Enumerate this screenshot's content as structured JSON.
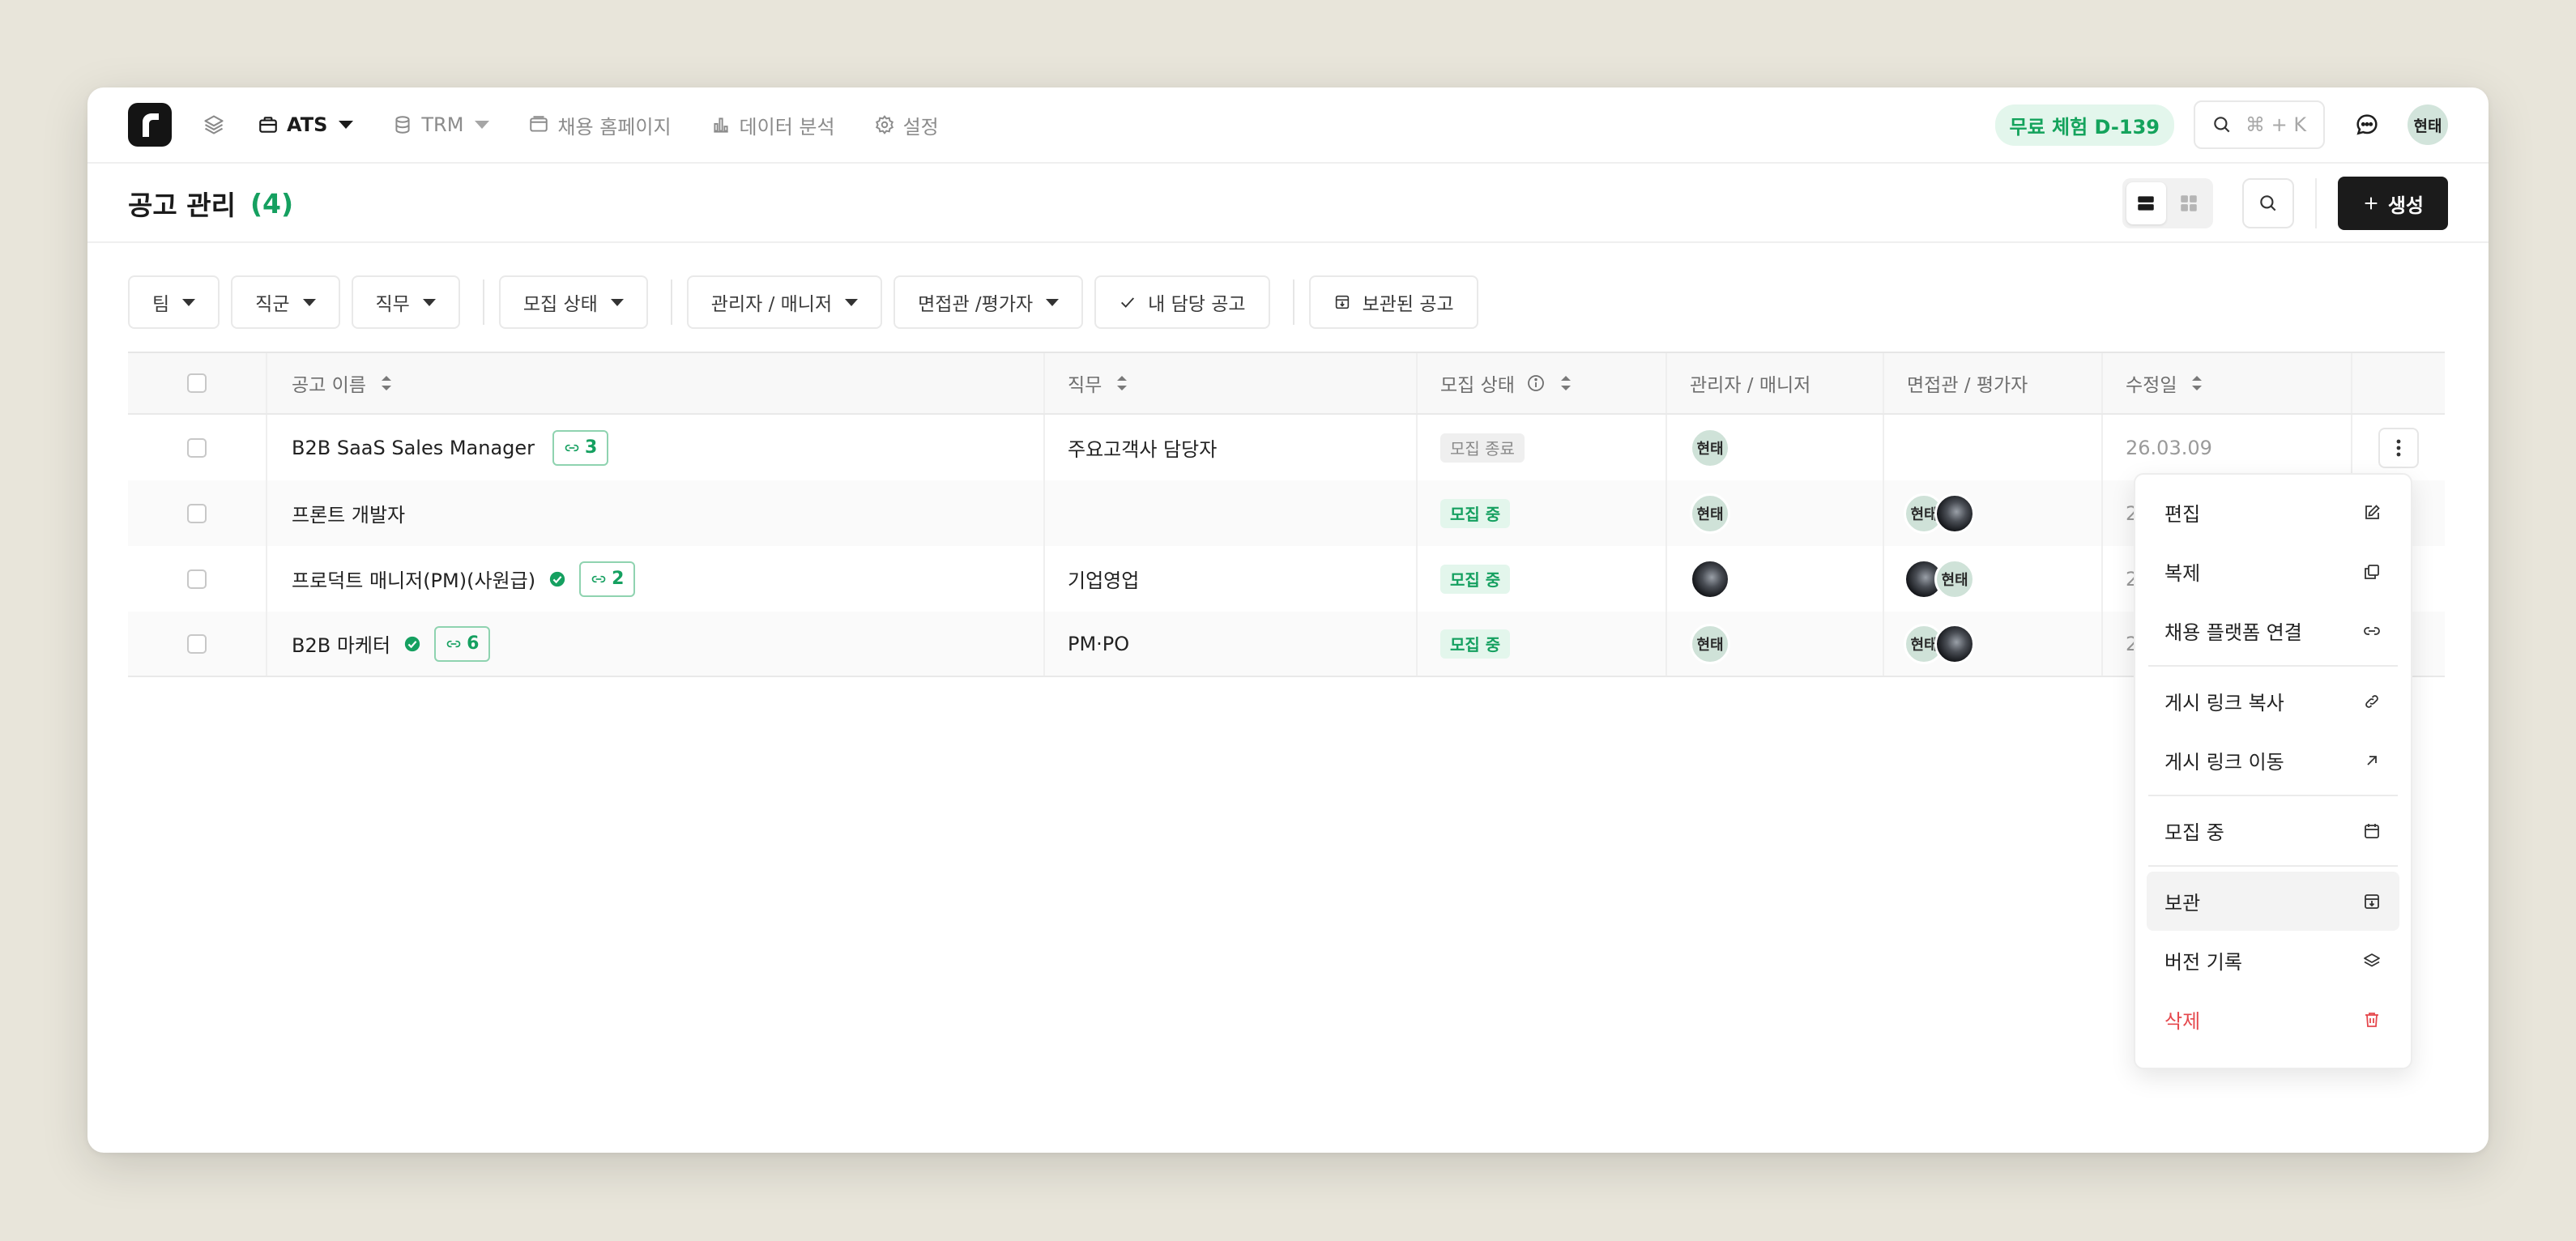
{
  "nav": {
    "items": [
      {
        "label": "ATS",
        "active": true,
        "icon": "briefcase-icon",
        "has_caret": true
      },
      {
        "label": "TRM",
        "active": false,
        "icon": "database-icon",
        "has_caret": true
      },
      {
        "label": "채용 홈페이지",
        "active": false,
        "icon": "browser-window-icon",
        "has_caret": false
      },
      {
        "label": "데이터 분석",
        "active": false,
        "icon": "bar-chart-icon",
        "has_caret": false
      },
      {
        "label": "설정",
        "active": false,
        "icon": "gear-icon",
        "has_caret": false
      }
    ],
    "trial_badge": "무료 체험 D-139",
    "search_shortcut": "⌘ + K",
    "user_avatar": "현태"
  },
  "page": {
    "title": "공고 관리",
    "count": "(4)",
    "create_label": "생성"
  },
  "filters": [
    "팀",
    "직군",
    "직무",
    "모집 상태",
    "관리자 / 매니저",
    "면접관 /평가자",
    "내 담당 공고",
    "보관된 공고"
  ],
  "table": {
    "headers": [
      "공고 이름",
      "직무",
      "모집 상태",
      "관리자 / 매니저",
      "면접관 / 평가자",
      "수정일"
    ],
    "rows": [
      {
        "name": "B2B SaaS Sales Manager",
        "verified": false,
        "links": "3",
        "job": "주요고객사 담당자",
        "status": "모집 종료",
        "status_type": "ended",
        "managers": [
          "현태"
        ],
        "interviewers": [],
        "date": "26.03.09"
      },
      {
        "name": "프론트 개발자",
        "verified": false,
        "links": "",
        "job": "",
        "status": "모집 중",
        "status_type": "open",
        "managers": [
          "현태"
        ],
        "interviewers": [
          "현태",
          "photo"
        ],
        "date": "2"
      },
      {
        "name": "프로덕트 매니저(PM)(사원급)",
        "verified": true,
        "links": "2",
        "job": "기업영업",
        "status": "모집 중",
        "status_type": "open",
        "managers": [
          "photo"
        ],
        "interviewers": [
          "photo",
          "현태"
        ],
        "date": "2"
      },
      {
        "name": "B2B 마케터",
        "verified": true,
        "links": "6",
        "job": "PM·PO",
        "status": "모집 중",
        "status_type": "open",
        "managers": [
          "현태"
        ],
        "interviewers": [
          "현태",
          "photo"
        ],
        "date": "2"
      }
    ]
  },
  "menu": {
    "groups": [
      [
        {
          "label": "편집",
          "icon": "edit-icon"
        },
        {
          "label": "복제",
          "icon": "copy-icon"
        },
        {
          "label": "채용 플랫폼 연결",
          "icon": "link-icon"
        }
      ],
      [
        {
          "label": "게시 링크 복사",
          "icon": "link-chain-icon"
        },
        {
          "label": "게시 링크 이동",
          "icon": "arrow-up-right-icon"
        }
      ],
      [
        {
          "label": "모집 중",
          "icon": "calendar-icon"
        }
      ],
      [
        {
          "label": "보관",
          "icon": "archive-icon",
          "hover": true
        },
        {
          "label": "버전 기록",
          "icon": "layers-icon"
        },
        {
          "label": "삭제",
          "icon": "trash-icon",
          "danger": true
        }
      ]
    ]
  },
  "colors": {
    "accent_green": "#15a060",
    "danger_red": "#e5484d",
    "primary_dark": "#1b1b1b"
  }
}
